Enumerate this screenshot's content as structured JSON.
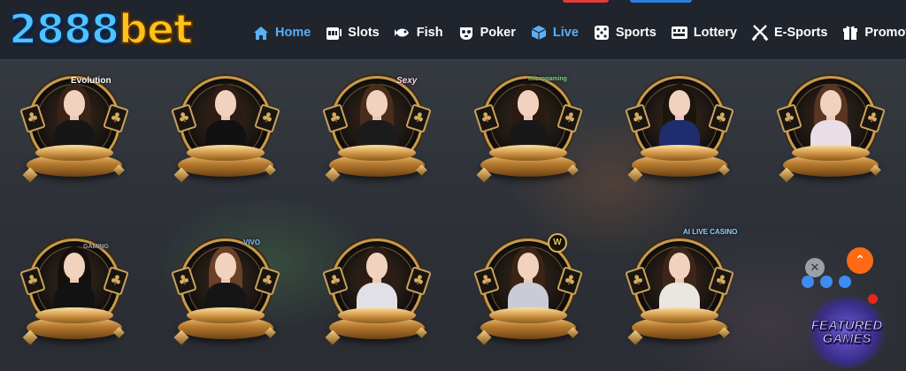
{
  "logo": {
    "num": "2888",
    "txt": "bet"
  },
  "nav": [
    {
      "label": "Home",
      "icon": "home-icon",
      "active": true
    },
    {
      "label": "Slots",
      "icon": "slot-machine-icon",
      "active": false
    },
    {
      "label": "Fish",
      "icon": "fish-icon",
      "active": false
    },
    {
      "label": "Poker",
      "icon": "poker-chip-icon",
      "active": false
    },
    {
      "label": "Live",
      "icon": "live-cube-icon",
      "active": true
    },
    {
      "label": "Sports",
      "icon": "dice-icon",
      "active": false
    },
    {
      "label": "Lottery",
      "icon": "lottery-icon",
      "active": false
    },
    {
      "label": "E-Sports",
      "icon": "crossed-swords-icon",
      "active": false
    },
    {
      "label": "Promotion",
      "icon": "gift-icon",
      "active": false
    }
  ],
  "providers_row1": [
    {
      "name": "evolution",
      "logo": "Evolution",
      "hair": "#3a2418",
      "outfit": "#161616"
    },
    {
      "name": "provider-2",
      "logo": "",
      "hair": "#2e1c14",
      "outfit": "#111111"
    },
    {
      "name": "sexy",
      "logo": "Sexy",
      "hair": "#4a2c1a",
      "outfit": "#1b1b1b"
    },
    {
      "name": "microgaming",
      "logo": "microgaming",
      "hair": "#2b1a10",
      "outfit": "#181818"
    },
    {
      "name": "provider-5",
      "logo": "",
      "hair": "#1e140e",
      "outfit": "#1d2d6e"
    },
    {
      "name": "provider-6",
      "logo": "",
      "hair": "#5a3524",
      "outfit": "#e9dde6"
    }
  ],
  "providers_row2": [
    {
      "name": "provider-7",
      "logo": "GAMING",
      "hair": "#16100c",
      "outfit": "#121212"
    },
    {
      "name": "vivo",
      "logo": "VIVO",
      "hair": "#6a4028",
      "outfit": "#151515"
    },
    {
      "name": "provider-9",
      "logo": "",
      "hair": "#2c1c14",
      "outfit": "#e0e0e6"
    },
    {
      "name": "provider-w",
      "logo": "W",
      "hair": "#3a2416",
      "outfit": "#c9ccd6"
    },
    {
      "name": "ai-live-casino",
      "logo": "AI LIVE CASINO",
      "hair": "#3d2618",
      "outfit": "#eae6e2"
    }
  ],
  "floating": {
    "close": "✕",
    "top": "⌃",
    "featured_line1": "FEATURED",
    "featured_line2": "GAMES"
  },
  "colors": {
    "nav_active": "#5ab0f5",
    "accent_orange": "#ff6a14",
    "gold": "#c89a4c"
  }
}
